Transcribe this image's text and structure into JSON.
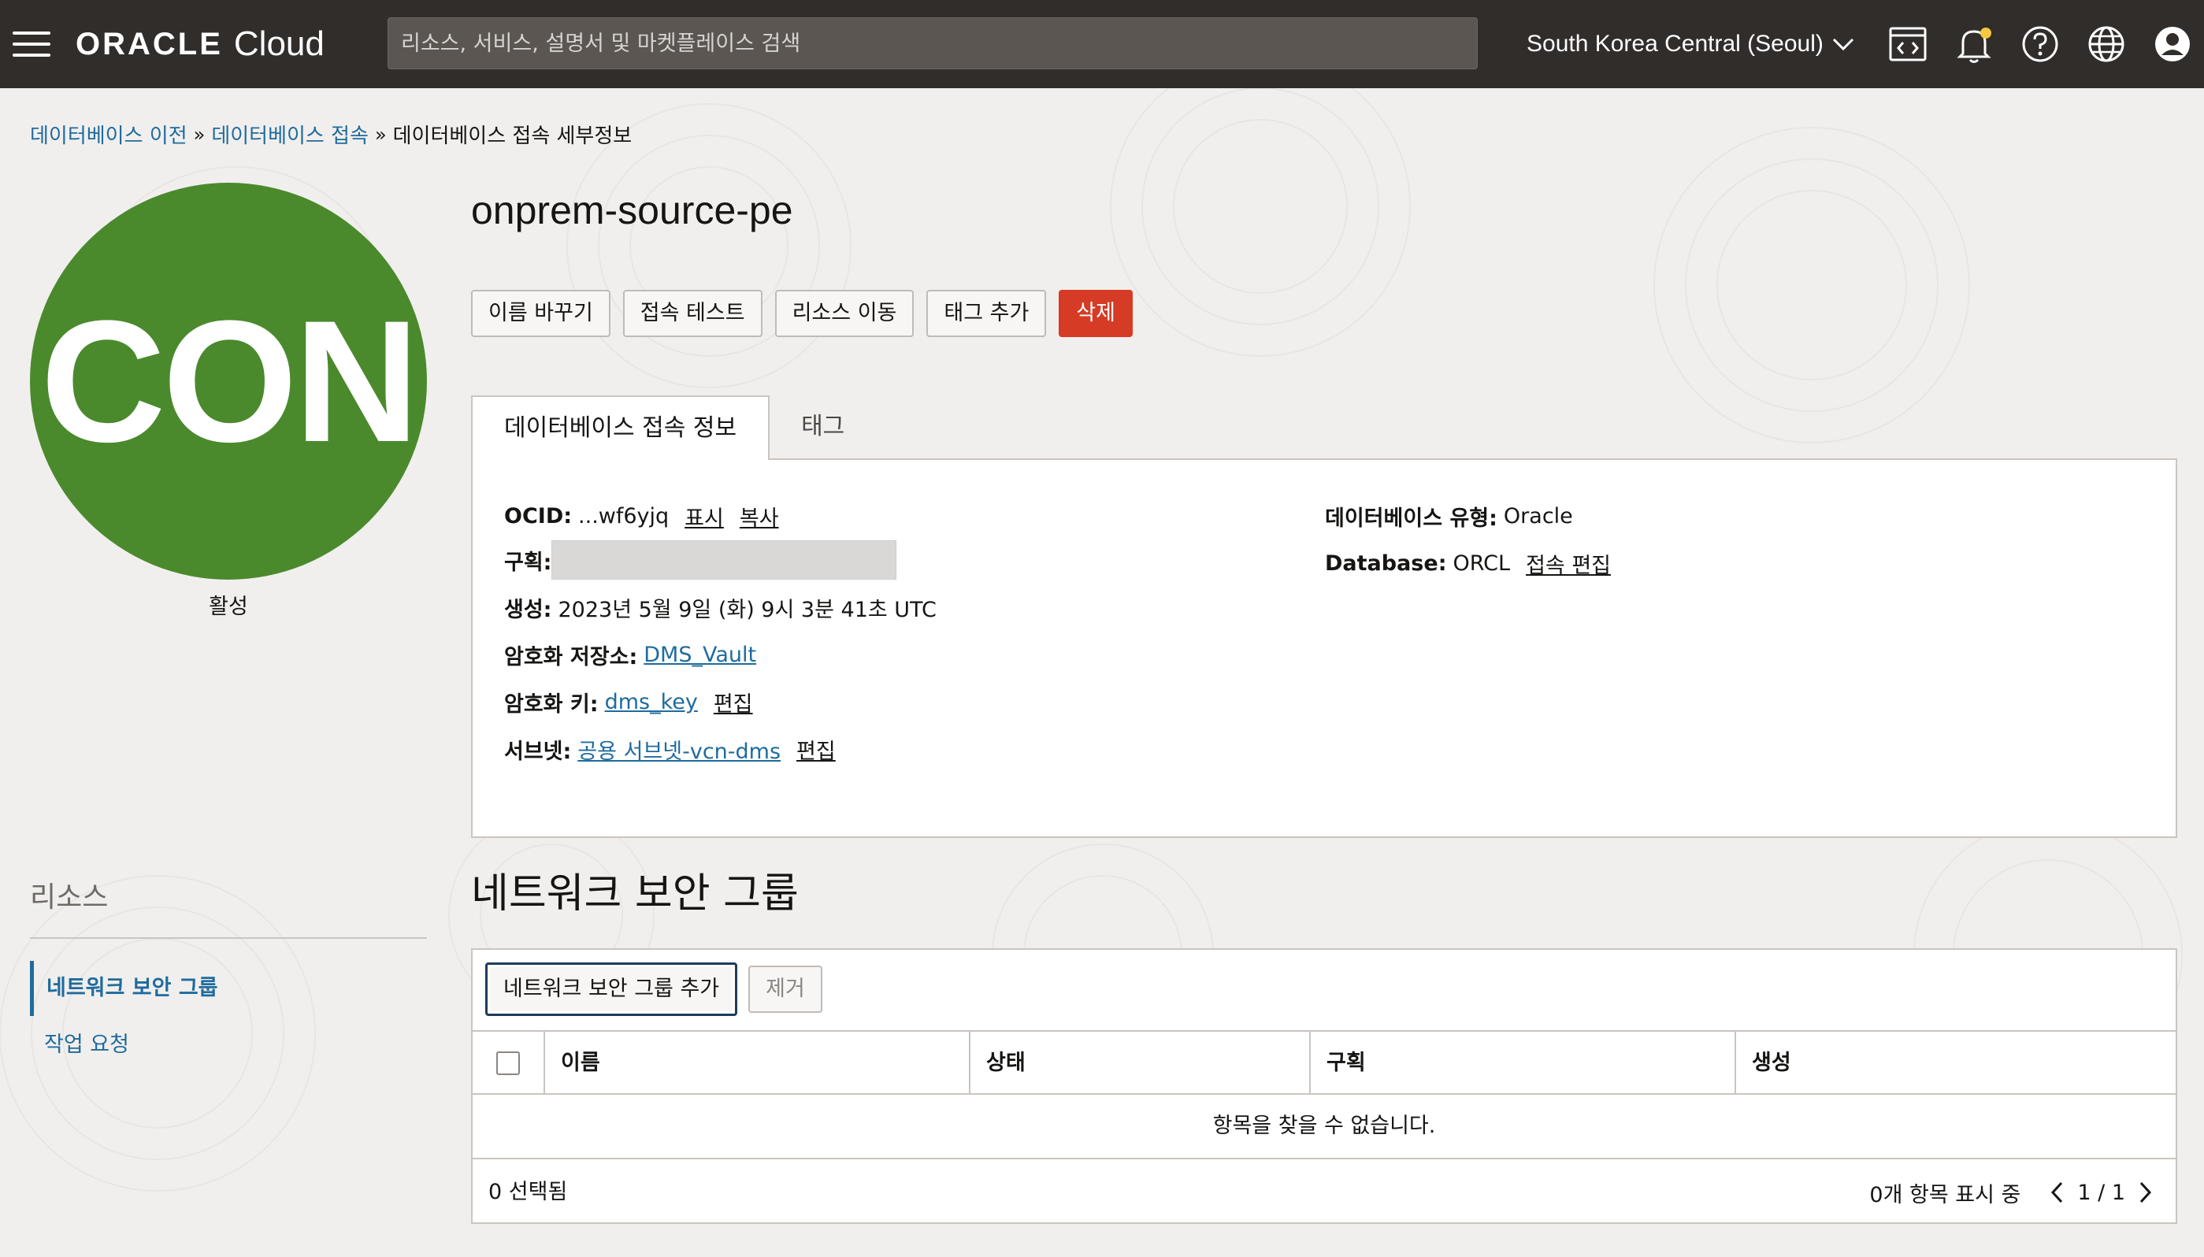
{
  "topbar": {
    "logo_oracle": "ORACLE",
    "logo_cloud": "Cloud",
    "search_placeholder": "리소스, 서비스, 설명서 및 마켓플레이스 검색",
    "region": "South Korea Central (Seoul)"
  },
  "breadcrumb": {
    "items": [
      "데이터베이스 이전",
      "데이터베이스 접속",
      "데이터베이스 접속 세부정보"
    ],
    "separator": "»"
  },
  "avatar": {
    "text": "CON",
    "status": "활성",
    "color": "#4a8a2d"
  },
  "resources": {
    "title": "리소스",
    "items": [
      "네트워크 보안 그룹",
      "작업 요청"
    ]
  },
  "page": {
    "title": "onprem-source-pe",
    "actions": [
      "이름 바꾸기",
      "접속 테스트",
      "리소스 이동",
      "태그 추가",
      "삭제"
    ],
    "tabs": [
      "데이터베이스 접속 정보",
      "태그"
    ]
  },
  "details": {
    "ocid_label": "OCID:",
    "ocid_value": "...wf6yjq",
    "ocid_show": "표시",
    "ocid_copy": "복사",
    "compartment_label": "구획:",
    "created_label": "생성:",
    "created_value": "2023년 5월 9일 (화) 9시 3분 41초 UTC",
    "vault_label": "암호화 저장소:",
    "vault_value": "DMS_Vault",
    "key_label": "암호화 키:",
    "key_value": "dms_key",
    "key_edit": "편집",
    "subnet_label": "서브넷:",
    "subnet_value": "공용 서브넷-vcn-dms",
    "subnet_edit": "편집",
    "db_type_label": "데이터베이스 유형:",
    "db_type_value": "Oracle",
    "database_label": "Database:",
    "database_value": "ORCL",
    "database_edit": "접속 편집"
  },
  "nsg": {
    "title": "네트워크 보안 그룹",
    "add_button": "네트워크 보안 그룹 추가",
    "remove_button": "제거",
    "columns": [
      "이름",
      "상태",
      "구획",
      "생성"
    ],
    "empty_message": "항목을 찾을 수 없습니다.",
    "selected": "0 선택됨",
    "showing": "0개 항목 표시 중",
    "page": "1 / 1"
  },
  "colors": {
    "topbar": "#312d2a",
    "link": "#1f6b9e",
    "danger": "#d63b25"
  }
}
